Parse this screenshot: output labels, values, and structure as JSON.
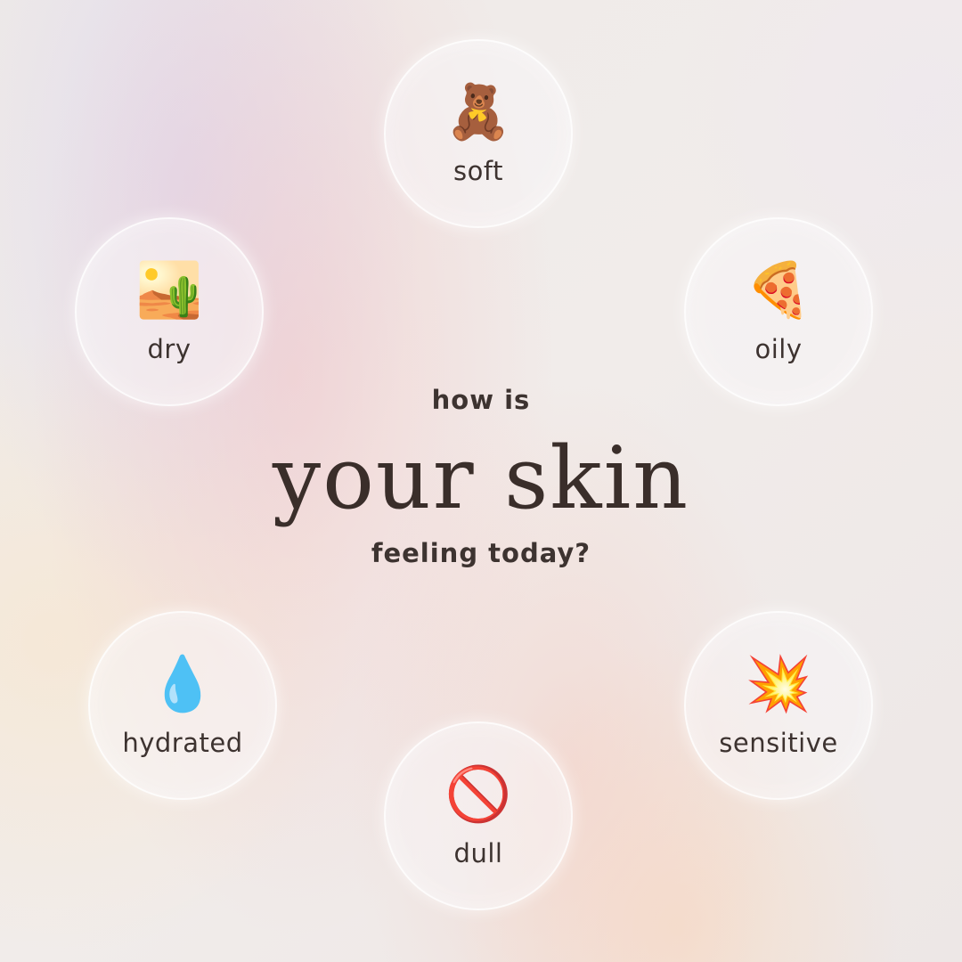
{
  "heading": {
    "top": "how is",
    "main": "your skin",
    "bottom": "feeling today?"
  },
  "options": {
    "soft": {
      "emoji": "🧸",
      "icon": "teddy-bear-icon",
      "label": "soft"
    },
    "dry": {
      "emoji": "🏜️",
      "icon": "desert-icon",
      "label": "dry"
    },
    "oily": {
      "emoji": "🍕",
      "icon": "pizza-slice-icon",
      "label": "oily"
    },
    "hydrated": {
      "emoji": "💧",
      "icon": "water-drop-icon",
      "label": "hydrated"
    },
    "sensitive": {
      "emoji": "💥",
      "icon": "collision-icon",
      "label": "sensitive"
    },
    "dull": {
      "emoji": "🚫",
      "icon": "prohibited-icon",
      "label": "dull"
    }
  },
  "colors": {
    "text": "#3d3330",
    "bubble_fill": "#f8f6f7",
    "bubble_border": "#ffffff"
  }
}
